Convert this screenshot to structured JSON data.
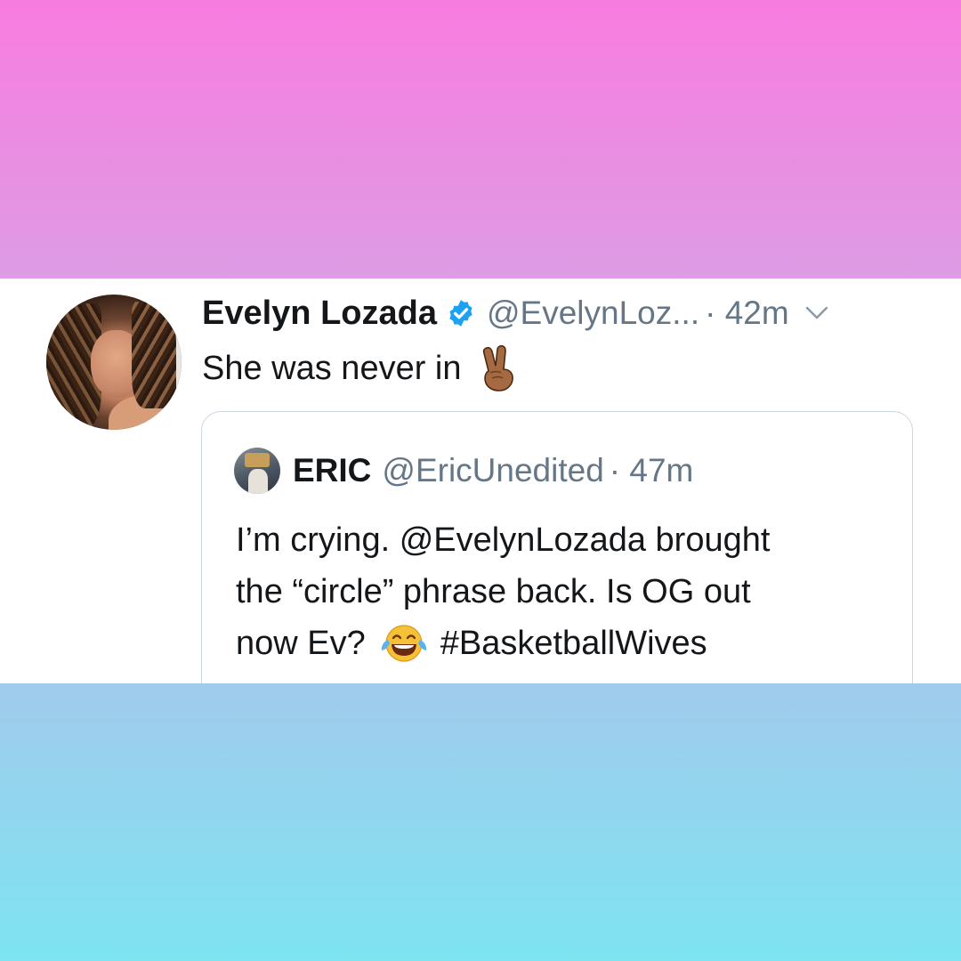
{
  "background": {
    "top_gradient": [
      "#f87ce0",
      "#dd9ce4"
    ],
    "bottom_gradient": [
      "#a1cbec",
      "#7de4f0"
    ]
  },
  "tweet": {
    "author_name": "Evelyn Lozada",
    "verified": true,
    "handle": "@EvelynLoz...",
    "timestamp": "· 42m",
    "text": "She was never in",
    "emoji": "victory-hand-emoji",
    "colors": {
      "text": "#14171a",
      "muted": "#657786",
      "verified": "#1da1f2"
    }
  },
  "quoted_tweet": {
    "author_name": "ERIC",
    "handle": "@EricUnedited",
    "timestamp": "· 47m",
    "lines": [
      "I’m crying. @EvelynLozada brought",
      "the “circle” phrase back. Is OG out",
      "now Ev?"
    ],
    "hashtag": "#BasketballWives",
    "emoji": "tears-of-joy-emoji"
  }
}
